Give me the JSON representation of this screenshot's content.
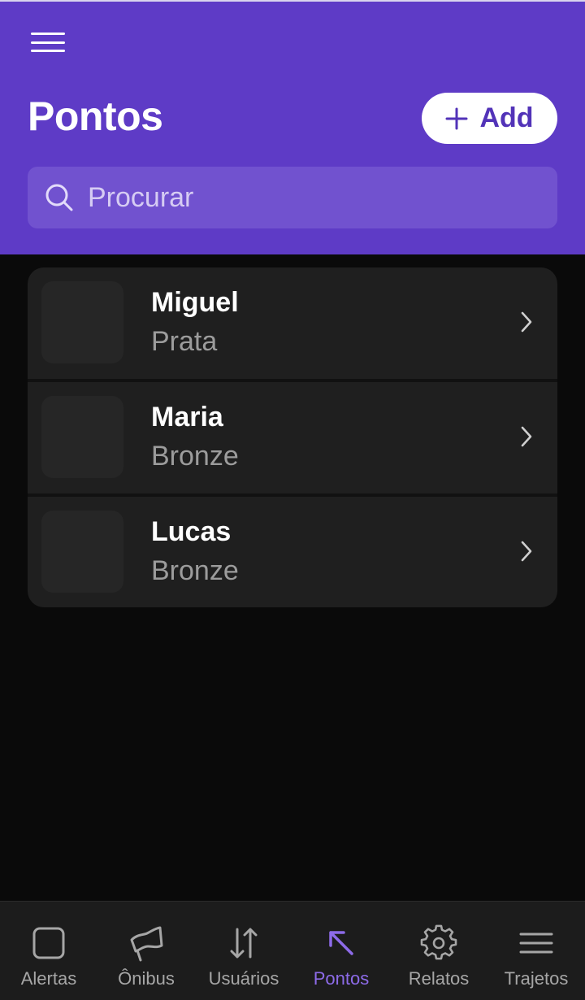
{
  "header": {
    "title": "Pontos",
    "add_label": "Add",
    "menu_icon": "hamburger-icon",
    "add_icon": "plus-icon"
  },
  "search": {
    "placeholder": "Procurar",
    "value": "",
    "icon": "search-icon"
  },
  "list": {
    "items": [
      {
        "name": "Miguel",
        "tier": "Prata"
      },
      {
        "name": "Maria",
        "tier": "Bronze"
      },
      {
        "name": "Lucas",
        "tier": "Bronze"
      }
    ]
  },
  "nav": {
    "items": [
      {
        "label": "Alertas",
        "icon": "square-icon",
        "active": false
      },
      {
        "label": "Ônibus",
        "icon": "flag-icon",
        "active": false
      },
      {
        "label": "Usuários",
        "icon": "sort-arrows-icon",
        "active": false
      },
      {
        "label": "Pontos",
        "icon": "arrow-up-left-icon",
        "active": true
      },
      {
        "label": "Relatos",
        "icon": "gear-icon",
        "active": false
      },
      {
        "label": "Trajetos",
        "icon": "menu-lines-icon",
        "active": false
      }
    ]
  },
  "colors": {
    "brand": "#5e3bc6",
    "accent": "#8d6be8",
    "background": "#0a0a0a",
    "card": "#1f1f1f"
  }
}
